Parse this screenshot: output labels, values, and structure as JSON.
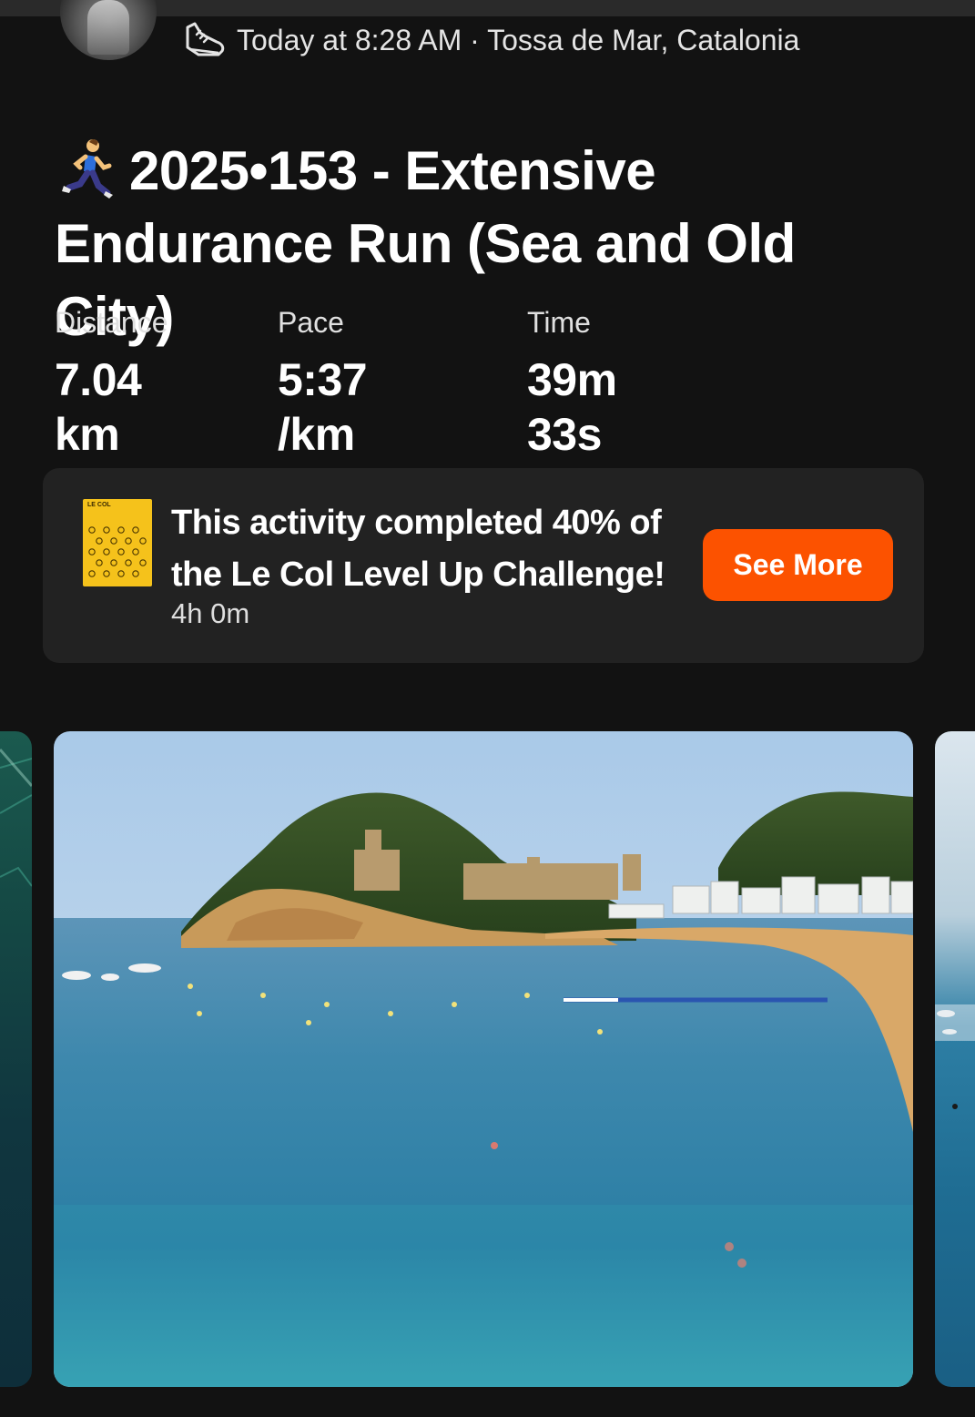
{
  "header": {
    "meta": "Today at 8:28 AM · Tossa de Mar, Catalonia"
  },
  "activity": {
    "title": "2025•153 -  Extensive Endurance Run (Sea and Old City)"
  },
  "stats": [
    {
      "label": "Distance",
      "value": "7.04 km"
    },
    {
      "label": "Pace",
      "value": "5:37 /km"
    },
    {
      "label": "Time",
      "value": "39m 33s"
    }
  ],
  "challenge": {
    "badge_text": "LE COL",
    "text": "This activity completed 40% of the Le Col Level Up Challenge!",
    "duration": "4h 0m",
    "button_label": "See More",
    "progress_percent": 40
  },
  "icons": {
    "shoe": "shoe-icon",
    "runner": "runner-icon"
  },
  "colors": {
    "accent": "#fc5200",
    "background": "#121212",
    "card": "#222222",
    "badge": "#f5c21b"
  }
}
